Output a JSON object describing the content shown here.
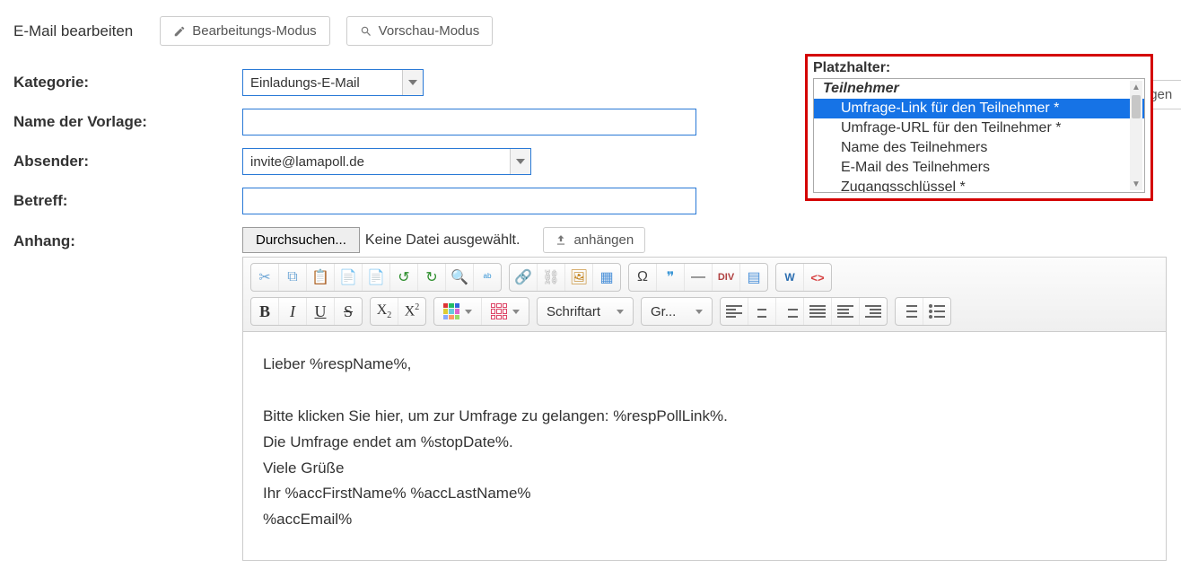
{
  "topbar": {
    "title": "E-Mail bearbeiten",
    "edit_mode": "Bearbeitungs-Modus",
    "preview_mode": "Vorschau-Modus"
  },
  "labels": {
    "category": "Kategorie:",
    "template_name": "Name der Vorlage:",
    "sender": "Absender:",
    "subject": "Betreff:",
    "attachment": "Anhang:"
  },
  "values": {
    "category": "Einladungs-E-Mail",
    "template_name": "",
    "sender": "invite@lamapoll.de",
    "subject": ""
  },
  "attachment": {
    "browse": "Durchsuchen...",
    "status": "Keine Datei ausgewählt.",
    "attach": "anhängen"
  },
  "placeholders": {
    "title": "Platzhalter:",
    "group": "Teilnehmer",
    "items": [
      "Umfrage-Link für den Teilnehmer *",
      "Umfrage-URL für den Teilnehmer *",
      "Name des Teilnehmers",
      "E-Mail des Teilnehmers",
      "Zugangsschlüssel *"
    ],
    "selected_index": 0,
    "insert": "Einfügen"
  },
  "toolbar": {
    "font_label": "Schriftart",
    "size_label": "Gr...",
    "div_label": "DIV",
    "word_label": "W",
    "src_label": "<>"
  },
  "body": {
    "l1": "Lieber %respName%,",
    "l2": "Bitte klicken Sie hier, um zur Umfrage zu gelangen: %respPollLink%.",
    "l3": "Die Umfrage endet am %stopDate%.",
    "l4": "Viele Grüße",
    "l5": "Ihr %accFirstName% %accLastName%",
    "l6": "%accEmail%"
  }
}
